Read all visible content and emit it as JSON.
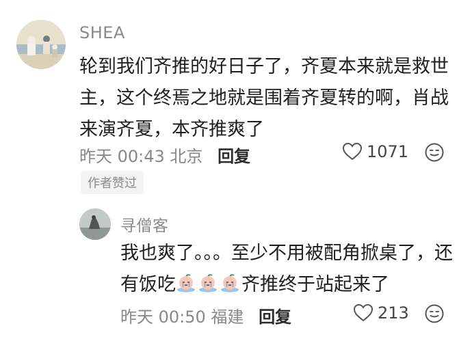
{
  "comment": {
    "author": "SHEA",
    "text": "轮到我们齐推的好日子了，齐夏本来就是救世主，这个终焉之地就是围着齐夏转的啊，肖战来演齐夏，本齐推爽了",
    "time": "昨天 00:43 北京",
    "reply_label": "回复",
    "likes": "1071",
    "badge": "作者赞过"
  },
  "reply": {
    "author": "寻僧客",
    "text_part1": "我也爽了。。。至少不用被配角掀桌了，还有饭吃",
    "text_part2": "齐推终于站起来了",
    "time": "昨天 00:50 福建",
    "reply_label": "回复",
    "likes": "213"
  },
  "icons": {
    "like": "heart-outline-icon",
    "emoji": "smile-icon",
    "inline_emoji": "crying-peach-emoji"
  }
}
